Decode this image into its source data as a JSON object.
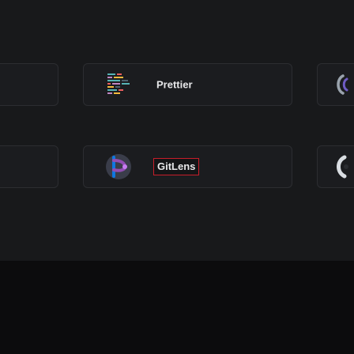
{
  "extensions": [
    {
      "name": "Prettier",
      "icon": "prettier-icon"
    },
    {
      "name": "GitLens",
      "icon": "gitlens-icon"
    }
  ],
  "colors": {
    "background": "#18191b",
    "card_border": "#2c2d31",
    "highlight_border": "#c81e2a",
    "gitlens_purple": "#914db3",
    "gitlens_blue": "#0e77e0"
  }
}
